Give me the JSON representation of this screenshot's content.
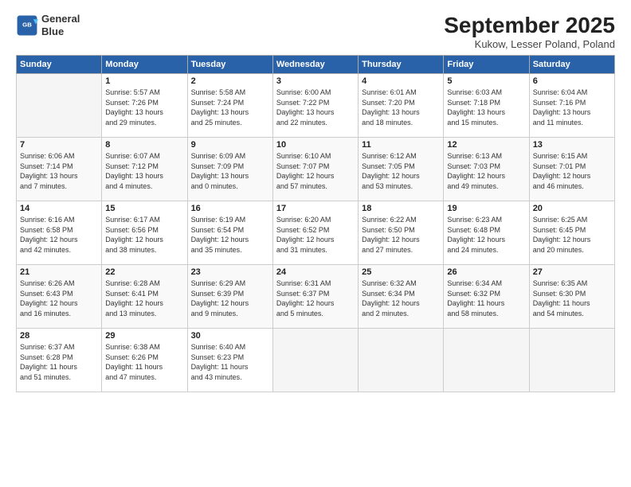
{
  "header": {
    "logo_line1": "General",
    "logo_line2": "Blue",
    "month_title": "September 2025",
    "subtitle": "Kukow, Lesser Poland, Poland"
  },
  "columns": [
    "Sunday",
    "Monday",
    "Tuesday",
    "Wednesday",
    "Thursday",
    "Friday",
    "Saturday"
  ],
  "weeks": [
    [
      {
        "day": "",
        "info": ""
      },
      {
        "day": "1",
        "info": "Sunrise: 5:57 AM\nSunset: 7:26 PM\nDaylight: 13 hours\nand 29 minutes."
      },
      {
        "day": "2",
        "info": "Sunrise: 5:58 AM\nSunset: 7:24 PM\nDaylight: 13 hours\nand 25 minutes."
      },
      {
        "day": "3",
        "info": "Sunrise: 6:00 AM\nSunset: 7:22 PM\nDaylight: 13 hours\nand 22 minutes."
      },
      {
        "day": "4",
        "info": "Sunrise: 6:01 AM\nSunset: 7:20 PM\nDaylight: 13 hours\nand 18 minutes."
      },
      {
        "day": "5",
        "info": "Sunrise: 6:03 AM\nSunset: 7:18 PM\nDaylight: 13 hours\nand 15 minutes."
      },
      {
        "day": "6",
        "info": "Sunrise: 6:04 AM\nSunset: 7:16 PM\nDaylight: 13 hours\nand 11 minutes."
      }
    ],
    [
      {
        "day": "7",
        "info": "Sunrise: 6:06 AM\nSunset: 7:14 PM\nDaylight: 13 hours\nand 7 minutes."
      },
      {
        "day": "8",
        "info": "Sunrise: 6:07 AM\nSunset: 7:12 PM\nDaylight: 13 hours\nand 4 minutes."
      },
      {
        "day": "9",
        "info": "Sunrise: 6:09 AM\nSunset: 7:09 PM\nDaylight: 13 hours\nand 0 minutes."
      },
      {
        "day": "10",
        "info": "Sunrise: 6:10 AM\nSunset: 7:07 PM\nDaylight: 12 hours\nand 57 minutes."
      },
      {
        "day": "11",
        "info": "Sunrise: 6:12 AM\nSunset: 7:05 PM\nDaylight: 12 hours\nand 53 minutes."
      },
      {
        "day": "12",
        "info": "Sunrise: 6:13 AM\nSunset: 7:03 PM\nDaylight: 12 hours\nand 49 minutes."
      },
      {
        "day": "13",
        "info": "Sunrise: 6:15 AM\nSunset: 7:01 PM\nDaylight: 12 hours\nand 46 minutes."
      }
    ],
    [
      {
        "day": "14",
        "info": "Sunrise: 6:16 AM\nSunset: 6:58 PM\nDaylight: 12 hours\nand 42 minutes."
      },
      {
        "day": "15",
        "info": "Sunrise: 6:17 AM\nSunset: 6:56 PM\nDaylight: 12 hours\nand 38 minutes."
      },
      {
        "day": "16",
        "info": "Sunrise: 6:19 AM\nSunset: 6:54 PM\nDaylight: 12 hours\nand 35 minutes."
      },
      {
        "day": "17",
        "info": "Sunrise: 6:20 AM\nSunset: 6:52 PM\nDaylight: 12 hours\nand 31 minutes."
      },
      {
        "day": "18",
        "info": "Sunrise: 6:22 AM\nSunset: 6:50 PM\nDaylight: 12 hours\nand 27 minutes."
      },
      {
        "day": "19",
        "info": "Sunrise: 6:23 AM\nSunset: 6:48 PM\nDaylight: 12 hours\nand 24 minutes."
      },
      {
        "day": "20",
        "info": "Sunrise: 6:25 AM\nSunset: 6:45 PM\nDaylight: 12 hours\nand 20 minutes."
      }
    ],
    [
      {
        "day": "21",
        "info": "Sunrise: 6:26 AM\nSunset: 6:43 PM\nDaylight: 12 hours\nand 16 minutes."
      },
      {
        "day": "22",
        "info": "Sunrise: 6:28 AM\nSunset: 6:41 PM\nDaylight: 12 hours\nand 13 minutes."
      },
      {
        "day": "23",
        "info": "Sunrise: 6:29 AM\nSunset: 6:39 PM\nDaylight: 12 hours\nand 9 minutes."
      },
      {
        "day": "24",
        "info": "Sunrise: 6:31 AM\nSunset: 6:37 PM\nDaylight: 12 hours\nand 5 minutes."
      },
      {
        "day": "25",
        "info": "Sunrise: 6:32 AM\nSunset: 6:34 PM\nDaylight: 12 hours\nand 2 minutes."
      },
      {
        "day": "26",
        "info": "Sunrise: 6:34 AM\nSunset: 6:32 PM\nDaylight: 11 hours\nand 58 minutes."
      },
      {
        "day": "27",
        "info": "Sunrise: 6:35 AM\nSunset: 6:30 PM\nDaylight: 11 hours\nand 54 minutes."
      }
    ],
    [
      {
        "day": "28",
        "info": "Sunrise: 6:37 AM\nSunset: 6:28 PM\nDaylight: 11 hours\nand 51 minutes."
      },
      {
        "day": "29",
        "info": "Sunrise: 6:38 AM\nSunset: 6:26 PM\nDaylight: 11 hours\nand 47 minutes."
      },
      {
        "day": "30",
        "info": "Sunrise: 6:40 AM\nSunset: 6:23 PM\nDaylight: 11 hours\nand 43 minutes."
      },
      {
        "day": "",
        "info": ""
      },
      {
        "day": "",
        "info": ""
      },
      {
        "day": "",
        "info": ""
      },
      {
        "day": "",
        "info": ""
      }
    ]
  ]
}
